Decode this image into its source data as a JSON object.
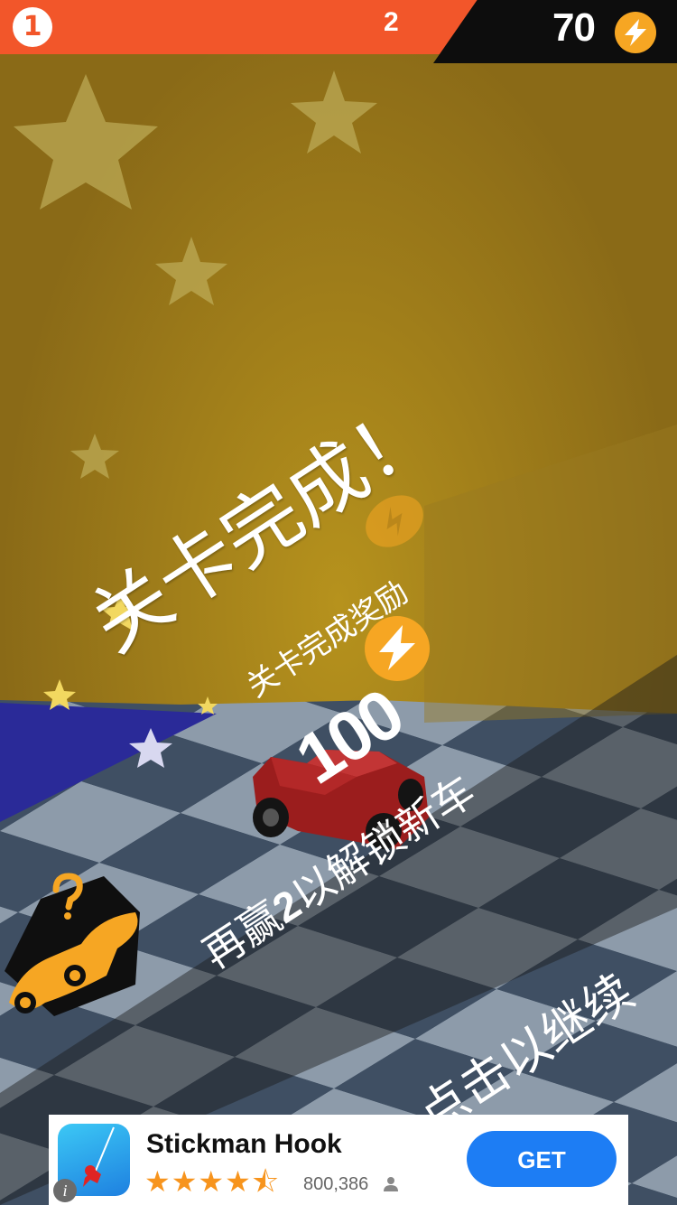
{
  "hud": {
    "current_level": "1",
    "next_level": "2",
    "coins": "70"
  },
  "level_complete": {
    "title": "关卡完成！",
    "reward_label": "关卡完成奖励",
    "reward_amount": "100"
  },
  "unlock": {
    "prefix": "再赢",
    "wins_needed": "2",
    "suffix": "以解锁新车"
  },
  "tap_to_continue": "点击以继续",
  "ad": {
    "app_name": "Stickman Hook",
    "rating_stars": "★★★★⯪",
    "rating_value": 4.5,
    "rating_count": "800,386",
    "cta": "GET",
    "info_glyph": "i"
  },
  "colors": {
    "hud_red": "#f2562a",
    "hud_black": "#0d0d0d",
    "background_gold": "#8a6a17",
    "coin_orange": "#f6a623",
    "cta_blue": "#1d7df4"
  },
  "icons": [
    "coin-lightning-icon",
    "mystery-car-icon",
    "star-rating-icon",
    "user-icon",
    "info-icon"
  ]
}
